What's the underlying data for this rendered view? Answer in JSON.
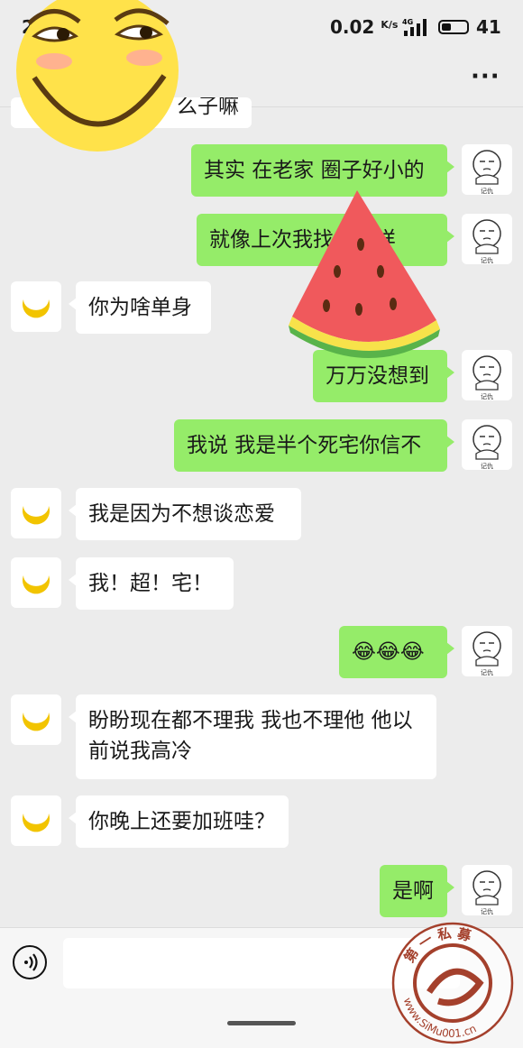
{
  "status_bar": {
    "time": "2",
    "speed_value": "0.02",
    "speed_unit": "K/s",
    "network": "4G",
    "battery_level": "41"
  },
  "header": {
    "more_icon": "more-icon",
    "more_label": "···"
  },
  "cut_off_message": {
    "text": "么子嘛"
  },
  "messages": [
    {
      "side": "me",
      "text": "其实 在老家 圈子好小的"
    },
    {
      "side": "me",
      "text": "就像上次我找你一样"
    },
    {
      "side": "other",
      "text": "你为啥单身"
    },
    {
      "side": "me",
      "text": "万万没想到"
    },
    {
      "side": "me",
      "text": "我说 我是半个死宅你信不"
    },
    {
      "side": "other",
      "text": "我是因为不想谈恋爱"
    },
    {
      "side": "other",
      "text": "我！超！宅！"
    },
    {
      "side": "me",
      "text": "😂😂😂"
    },
    {
      "side": "other",
      "text": "盼盼现在都不理我 我也不理他 他以前说我高冷"
    },
    {
      "side": "other",
      "text": "你晚上还要加班哇？"
    },
    {
      "side": "me",
      "text": "是啊"
    }
  ],
  "avatars": {
    "me_caption": "记仇",
    "other_icon": "moon-icon"
  },
  "input": {
    "placeholder": "",
    "value": ""
  },
  "watermark": {
    "text": "第一私募 www.SiMu001.cn"
  },
  "colors": {
    "me_bubble": "#95ec69",
    "other_bubble": "#ffffff",
    "background": "#ececec"
  }
}
